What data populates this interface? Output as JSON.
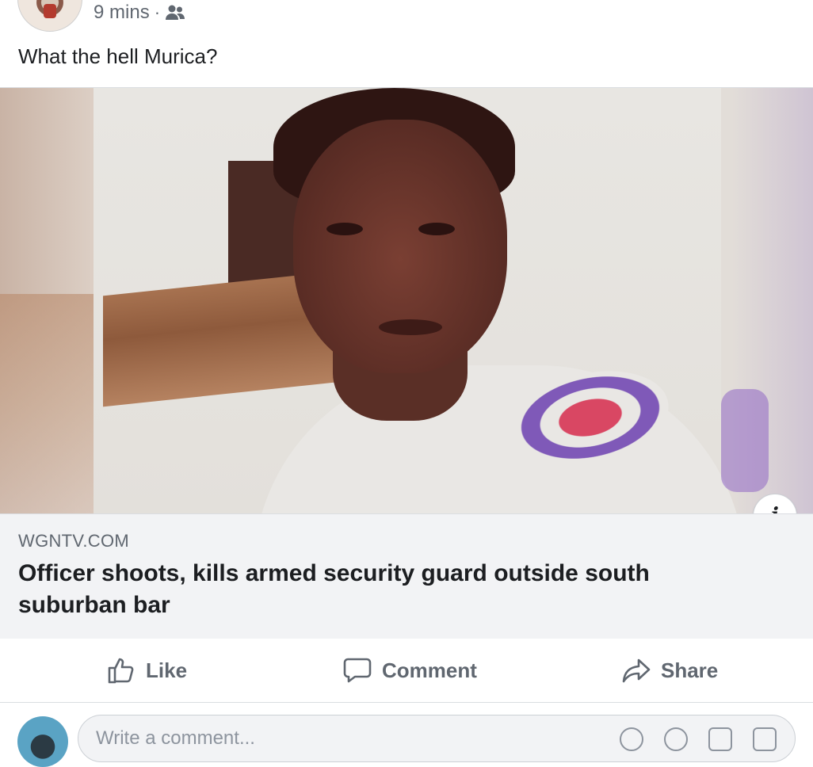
{
  "post": {
    "time": "9 mins",
    "separator": "·",
    "audience_icon": "friends-icon",
    "text": "What the hell Murica?"
  },
  "link": {
    "domain": "WGNTV.COM",
    "title": "Officer shoots, kills armed security guard outside south suburban bar",
    "info_label": "i"
  },
  "actions": {
    "like_label": "Like",
    "comment_label": "Comment",
    "share_label": "Share"
  },
  "comment_box": {
    "placeholder": "Write a comment..."
  },
  "colors": {
    "text_primary": "#1c1e21",
    "text_secondary": "#606770",
    "card_meta_bg": "#f2f3f5",
    "border": "#dadde1"
  }
}
